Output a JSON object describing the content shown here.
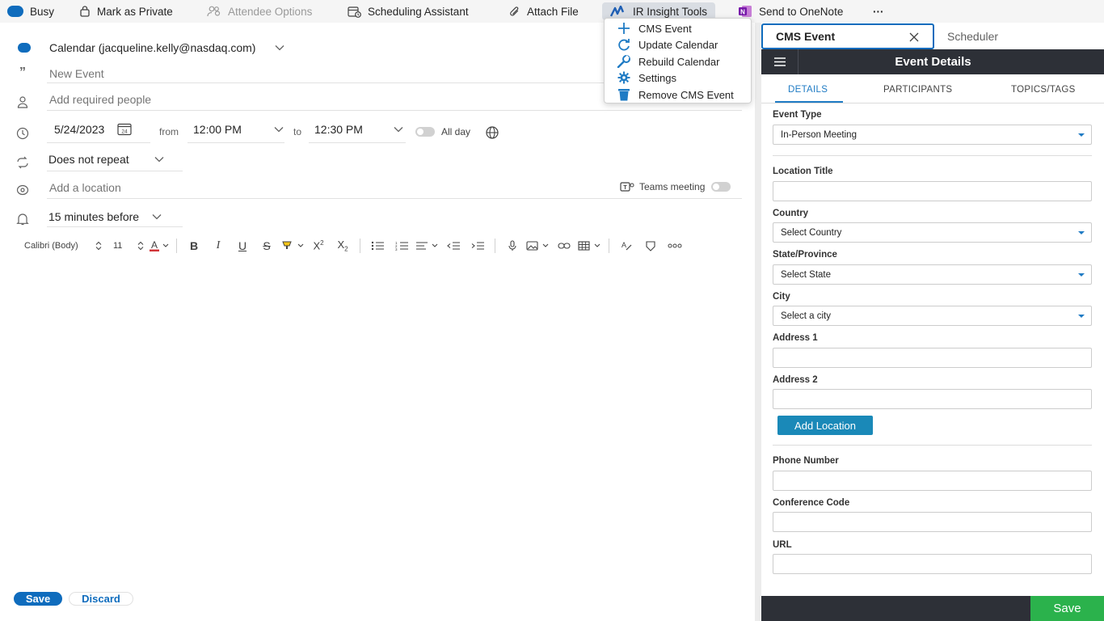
{
  "colors": {
    "accent": "#0f6cbd",
    "sidepane_header": "#2d3037",
    "save_green": "#2bb24c",
    "add_location": "#1a89b8"
  },
  "ribbon": {
    "busy": "Busy",
    "mark_private": "Mark as Private",
    "attendee_options": "Attendee Options",
    "scheduling_assistant": "Scheduling Assistant",
    "attach_file": "Attach File",
    "ir_insight_tools": "IR Insight Tools",
    "send_onenote": "Send to OneNote",
    "more": "···"
  },
  "menu": {
    "items": [
      {
        "label": "CMS Event",
        "icon": "plus-icon"
      },
      {
        "label": "Update Calendar",
        "icon": "refresh-icon"
      },
      {
        "label": "Rebuild Calendar",
        "icon": "wrench-icon"
      },
      {
        "label": "Settings",
        "icon": "gear-icon"
      },
      {
        "label": "Remove CMS Event",
        "icon": "trash-icon"
      }
    ]
  },
  "compose": {
    "calendar": "Calendar (jacqueline.kelly@nasdaq.com)",
    "title_placeholder": "New Event",
    "people_placeholder": "Add required people",
    "date": "5/24/2023",
    "from_label": "from",
    "start_time": "12:00 PM",
    "to_label": "to",
    "end_time": "12:30 PM",
    "all_day": "All day",
    "repeat": "Does not repeat",
    "location_placeholder": "Add a location",
    "teams_meeting": "Teams meeting",
    "reminder": "15 minutes before",
    "font": "Calibri (Body)",
    "font_size": "11",
    "save": "Save",
    "discard": "Discard"
  },
  "pane": {
    "tab_cms": "CMS Event",
    "tab_scheduler": "Scheduler",
    "header_title": "Event Details",
    "tabs": [
      "DETAILS",
      "PARTICIPANTS",
      "TOPICS/TAGS"
    ],
    "event_type_label": "Event Type",
    "event_type_value": "In-Person Meeting",
    "location_title_label": "Location Title",
    "country_label": "Country",
    "country_value": "Select Country",
    "state_label": "State/Province",
    "state_value": "Select State",
    "city_label": "City",
    "city_value": "Select a city",
    "address1_label": "Address 1",
    "address2_label": "Address 2",
    "add_location": "Add Location",
    "phone_label": "Phone Number",
    "conference_label": "Conference Code",
    "url_label": "URL",
    "save": "Save"
  }
}
